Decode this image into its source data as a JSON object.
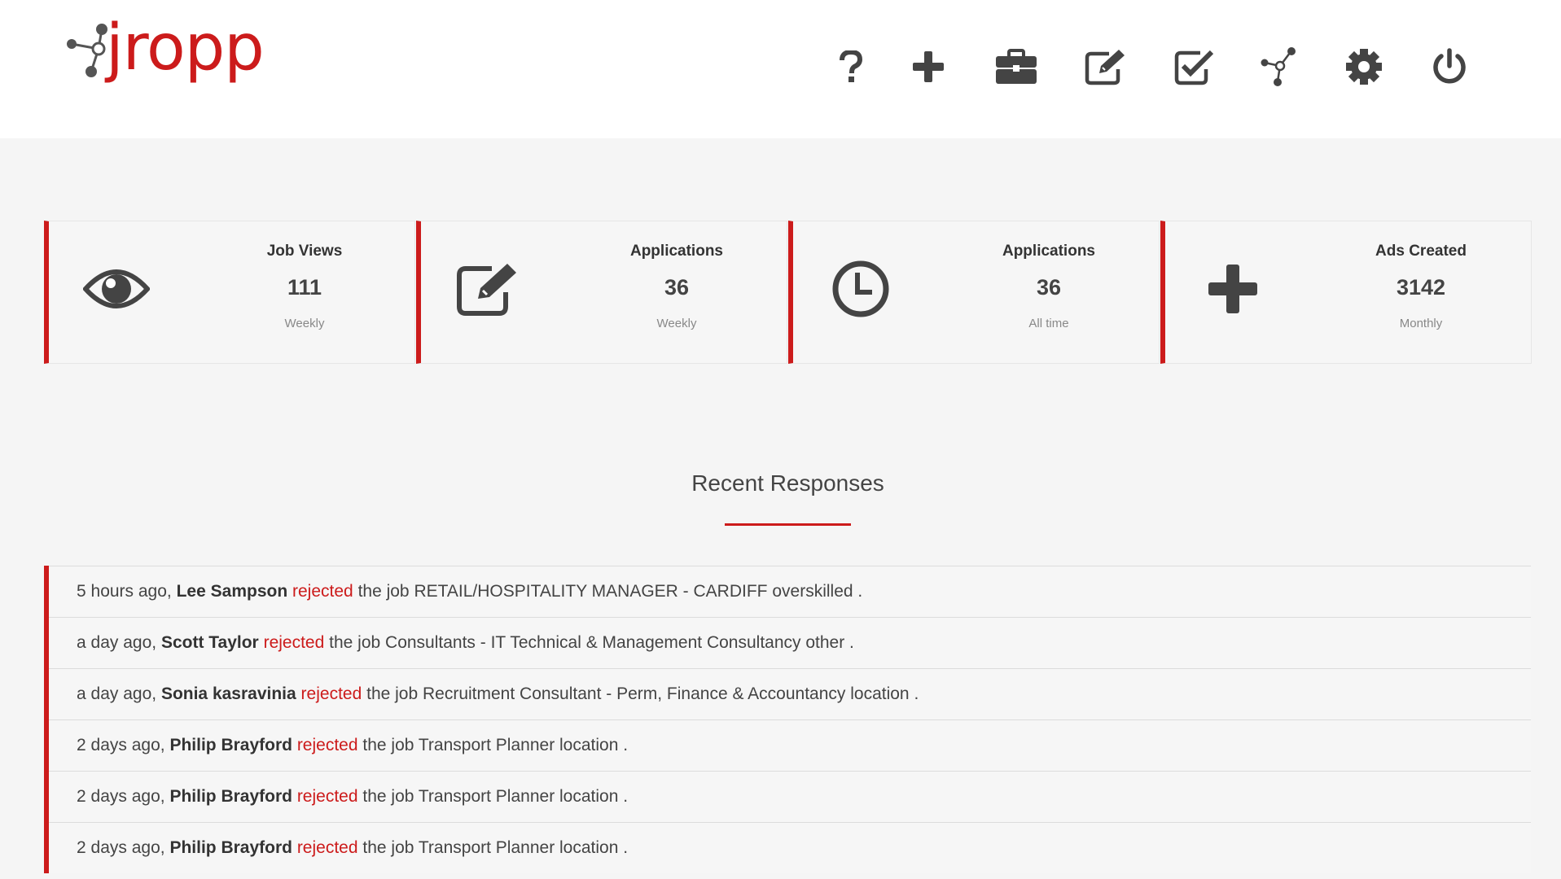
{
  "brand": {
    "name": "jropp",
    "accent": "#cc1b1b"
  },
  "nav": [
    {
      "name": "help-icon",
      "label": "Help"
    },
    {
      "name": "add-icon",
      "label": "Add"
    },
    {
      "name": "briefcase-icon",
      "label": "Jobs"
    },
    {
      "name": "edit-icon",
      "label": "Edit"
    },
    {
      "name": "checkbox-icon",
      "label": "Approve"
    },
    {
      "name": "network-icon",
      "label": "Network"
    },
    {
      "name": "gear-icon",
      "label": "Settings"
    },
    {
      "name": "power-icon",
      "label": "Log out"
    }
  ],
  "stats": [
    {
      "icon": "eye-icon",
      "title": "Job Views",
      "value": "111",
      "period": "Weekly"
    },
    {
      "icon": "edit-icon",
      "title": "Applications",
      "value": "36",
      "period": "Weekly"
    },
    {
      "icon": "clock-icon",
      "title": "Applications",
      "value": "36",
      "period": "All time"
    },
    {
      "icon": "plus-icon",
      "title": "Ads Created",
      "value": "3142",
      "period": "Monthly"
    }
  ],
  "recent": {
    "title": "Recent Responses",
    "items": [
      {
        "time": "5 hours ago,",
        "name": "Lee Sampson",
        "action": "rejected",
        "rest": "the job RETAIL/HOSPITALITY MANAGER - CARDIFF overskilled ."
      },
      {
        "time": "a day ago,",
        "name": "Scott Taylor",
        "action": "rejected",
        "rest": "the job Consultants - IT Technical & Management Consultancy other ."
      },
      {
        "time": "a day ago,",
        "name": "Sonia kasravinia",
        "action": "rejected",
        "rest": "the job Recruitment Consultant - Perm, Finance & Accountancy location ."
      },
      {
        "time": "2 days ago,",
        "name": "Philip Brayford",
        "action": "rejected",
        "rest": "the job Transport Planner location ."
      },
      {
        "time": "2 days ago,",
        "name": "Philip Brayford",
        "action": "rejected",
        "rest": "the job Transport Planner location ."
      },
      {
        "time": "2 days ago,",
        "name": "Philip Brayford",
        "action": "rejected",
        "rest": "the job Transport Planner location ."
      }
    ]
  }
}
